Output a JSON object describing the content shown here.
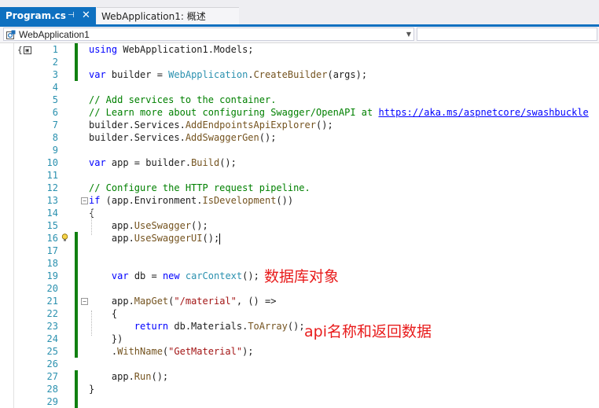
{
  "tabs": [
    {
      "label": "Program.cs",
      "pin": "⊣",
      "close": "✕",
      "active": true
    },
    {
      "label": "WebApplication1: 概述",
      "active": false
    }
  ],
  "navbar": {
    "project": "WebApplication1",
    "project_icon": "csharp-project-icon"
  },
  "lines": [
    {
      "n": "1",
      "tokens": [
        [
          "kw",
          "using"
        ],
        [
          "",
          " WebApplication1.Models;"
        ]
      ]
    },
    {
      "n": "2",
      "tokens": []
    },
    {
      "n": "3",
      "tokens": [
        [
          "kw",
          "var"
        ],
        [
          "",
          " builder = "
        ],
        [
          "ty",
          "WebApplication"
        ],
        [
          "",
          "."
        ],
        [
          "mt",
          "CreateBuilder"
        ],
        [
          "",
          "(args);"
        ]
      ]
    },
    {
      "n": "4",
      "tokens": []
    },
    {
      "n": "5",
      "tokens": [
        [
          "cm",
          "// Add services to the container."
        ]
      ]
    },
    {
      "n": "6",
      "tokens": [
        [
          "cm",
          "// Learn more about configuring Swagger/OpenAPI at "
        ],
        [
          "lk",
          "https://aka.ms/aspnetcore/swashbuckle"
        ]
      ]
    },
    {
      "n": "7",
      "tokens": [
        [
          "",
          "builder.Services."
        ],
        [
          "mt",
          "AddEndpointsApiExplorer"
        ],
        [
          "",
          "();"
        ]
      ]
    },
    {
      "n": "8",
      "tokens": [
        [
          "",
          "builder.Services."
        ],
        [
          "mt",
          "AddSwaggerGen"
        ],
        [
          "",
          "();"
        ]
      ]
    },
    {
      "n": "9",
      "tokens": []
    },
    {
      "n": "10",
      "tokens": [
        [
          "kw",
          "var"
        ],
        [
          "",
          " app = builder."
        ],
        [
          "mt",
          "Build"
        ],
        [
          "",
          "();"
        ]
      ]
    },
    {
      "n": "11",
      "tokens": []
    },
    {
      "n": "12",
      "tokens": [
        [
          "cm",
          "// Configure the HTTP request pipeline."
        ]
      ]
    },
    {
      "n": "13",
      "tokens": [
        [
          "kw",
          "if"
        ],
        [
          "",
          " (app.Environment."
        ],
        [
          "mt",
          "IsDevelopment"
        ],
        [
          "",
          "())"
        ]
      ]
    },
    {
      "n": "14",
      "tokens": [
        [
          "",
          "{"
        ]
      ]
    },
    {
      "n": "15",
      "tokens": [
        [
          "",
          "    app."
        ],
        [
          "mt",
          "UseSwagger"
        ],
        [
          "",
          "();"
        ]
      ]
    },
    {
      "n": "16",
      "tokens": [
        [
          "",
          "    app."
        ],
        [
          "mt",
          "UseSwaggerUI"
        ],
        [
          "",
          "();"
        ]
      ]
    },
    {
      "n": "17",
      "tokens": []
    },
    {
      "n": "18",
      "tokens": []
    },
    {
      "n": "19",
      "tokens": [
        [
          "",
          "    "
        ],
        [
          "kw",
          "var"
        ],
        [
          "",
          " db = "
        ],
        [
          "kw",
          "new"
        ],
        [
          "",
          " "
        ],
        [
          "ty",
          "carContext"
        ],
        [
          "",
          "();"
        ]
      ]
    },
    {
      "n": "20",
      "tokens": []
    },
    {
      "n": "21",
      "tokens": [
        [
          "",
          "    app."
        ],
        [
          "mt",
          "MapGet"
        ],
        [
          "",
          "("
        ],
        [
          "st",
          "\"/material\""
        ],
        [
          "",
          ", () =>"
        ]
      ]
    },
    {
      "n": "22",
      "tokens": [
        [
          "",
          "    {"
        ]
      ]
    },
    {
      "n": "23",
      "tokens": [
        [
          "",
          "        "
        ],
        [
          "kw",
          "return"
        ],
        [
          "",
          " db.Materials."
        ],
        [
          "mt",
          "ToArray"
        ],
        [
          "",
          "();"
        ]
      ]
    },
    {
      "n": "24",
      "tokens": [
        [
          "",
          "    })"
        ]
      ]
    },
    {
      "n": "25",
      "tokens": [
        [
          "",
          "    ."
        ],
        [
          "mt",
          "WithName"
        ],
        [
          "",
          "("
        ],
        [
          "st",
          "\"GetMaterial\""
        ],
        [
          "",
          ");"
        ]
      ]
    },
    {
      "n": "26",
      "tokens": []
    },
    {
      "n": "27",
      "tokens": [
        [
          "",
          "    app."
        ],
        [
          "mt",
          "Run"
        ],
        [
          "",
          "();"
        ]
      ]
    },
    {
      "n": "28",
      "tokens": [
        [
          "",
          "}"
        ]
      ]
    },
    {
      "n": "29",
      "tokens": []
    }
  ],
  "annotations": {
    "db_object": "数据库对象",
    "api_return": "api名称和返回数据"
  },
  "colors": {
    "keyword": "#0000ff",
    "comment": "#008000",
    "type": "#2b91af",
    "string": "#a31515",
    "change_marker": "#108010",
    "annotation": "#e81c1c",
    "active_tab": "#0e70c0"
  }
}
